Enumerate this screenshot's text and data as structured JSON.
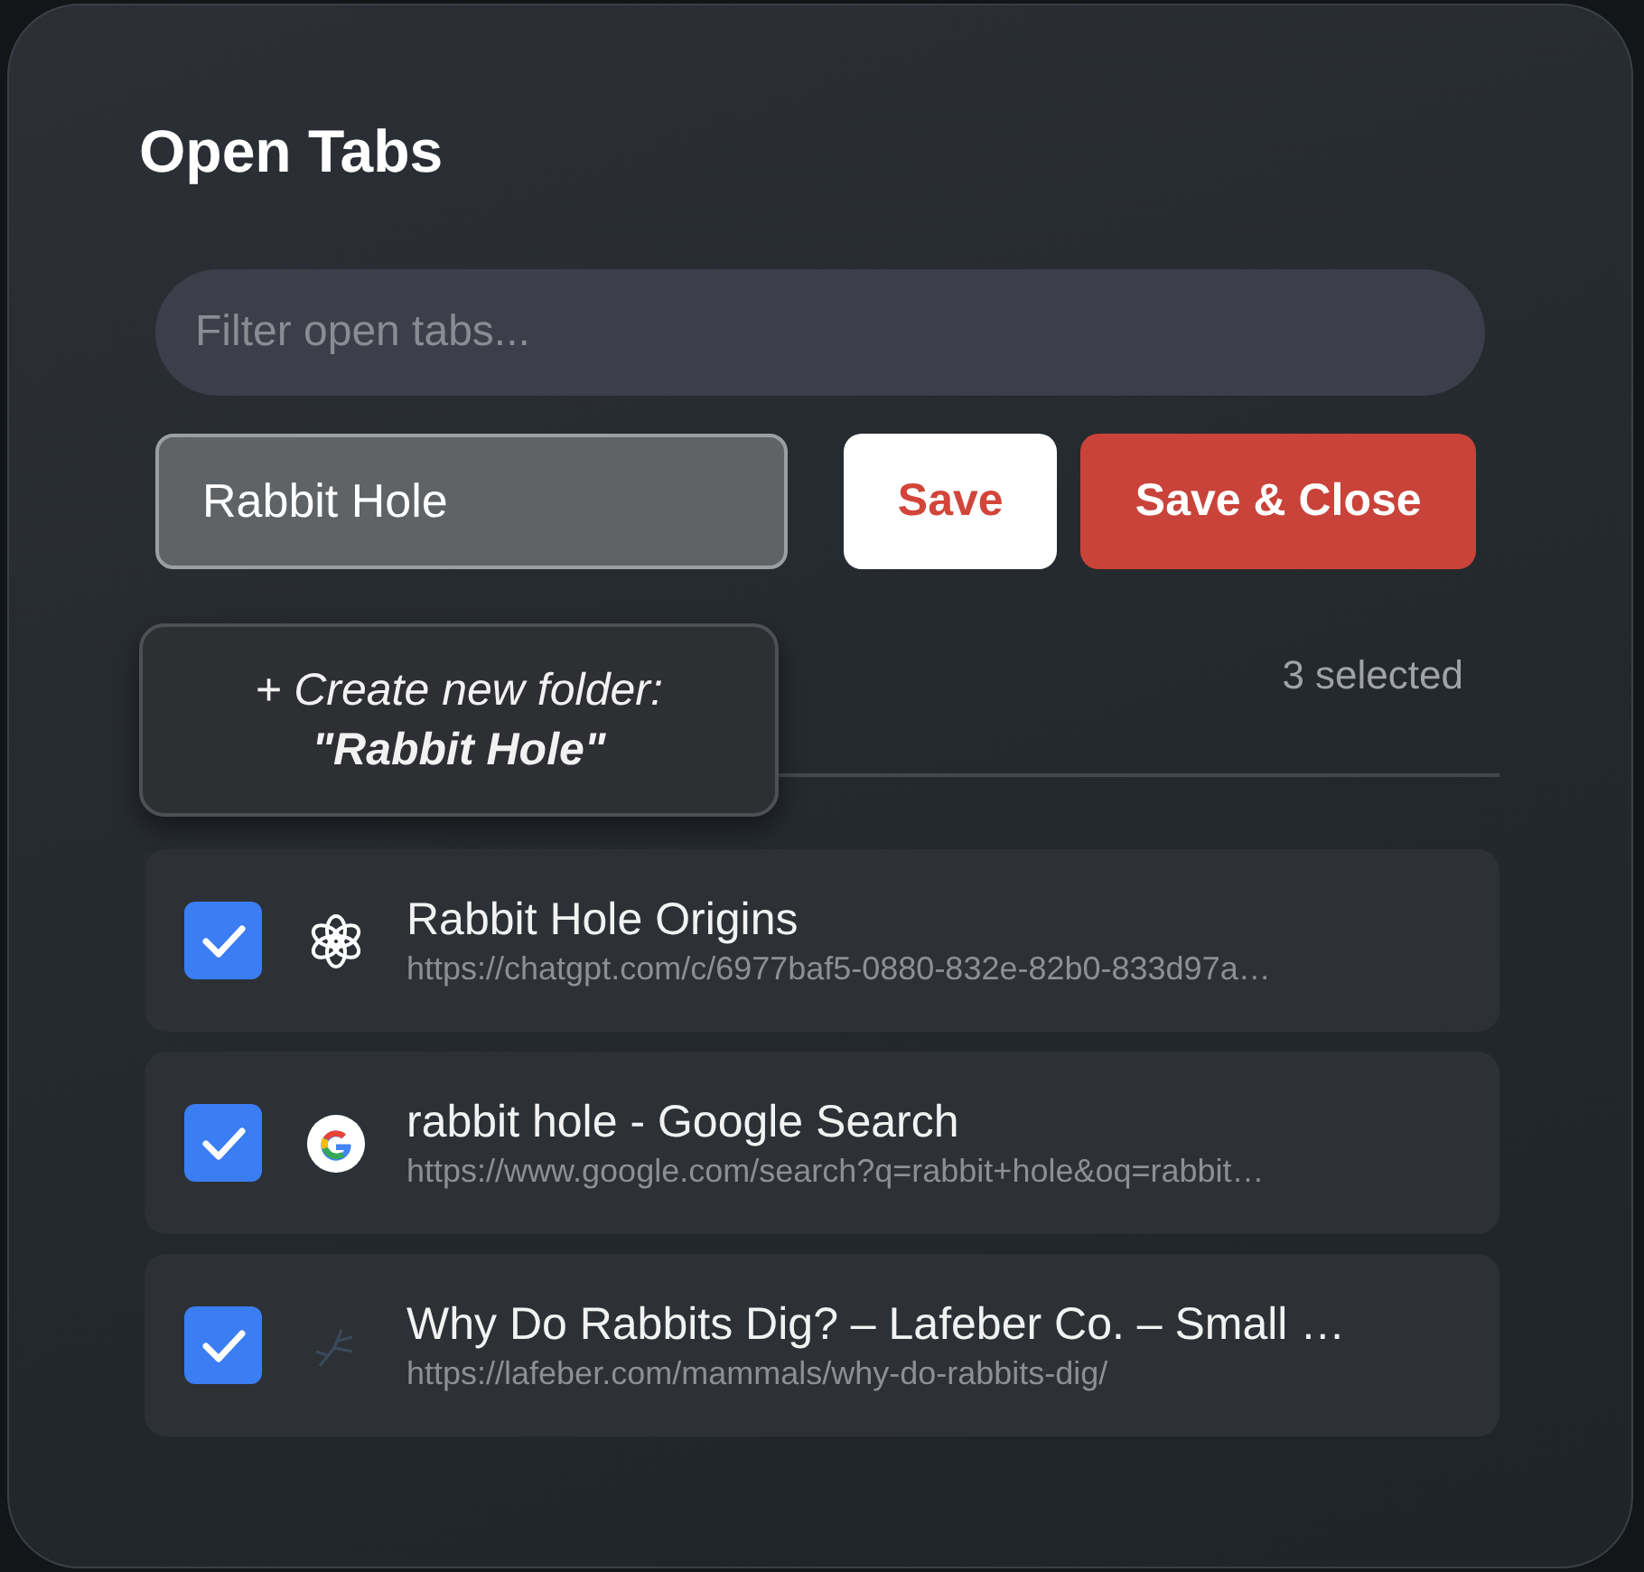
{
  "title": "Open Tabs",
  "filter": {
    "placeholder": "Filter open tabs..."
  },
  "folder_input": {
    "value": "Rabbit Hole"
  },
  "buttons": [
    {
      "label": "Save",
      "kind": "secondary"
    },
    {
      "label": "Save & Close",
      "kind": "primary"
    }
  ],
  "folder_suggestion": "+ Create new folder:\n**\"Rabbit Hole\"**",
  "selected_count": "3 selected",
  "tabs": [
    {
      "title": "Rabbit Hole Origins",
      "url": "https://chatgpt.com/c/6977baf5-0880-832e-82b0-833d97a…",
      "checked": true
    },
    {
      "title": "rabbit hole - Google Search",
      "url": "https://www.google.com/search?q=rabbit+hole&oq=rabbit…",
      "checked": true
    },
    {
      "title": "Why Do Rabbits Dig? – Lafeber Co. – Small …",
      "url": "https://lafeber.com/mammals/why-do-rabbits-dig/",
      "checked": true
    }
  ]
}
